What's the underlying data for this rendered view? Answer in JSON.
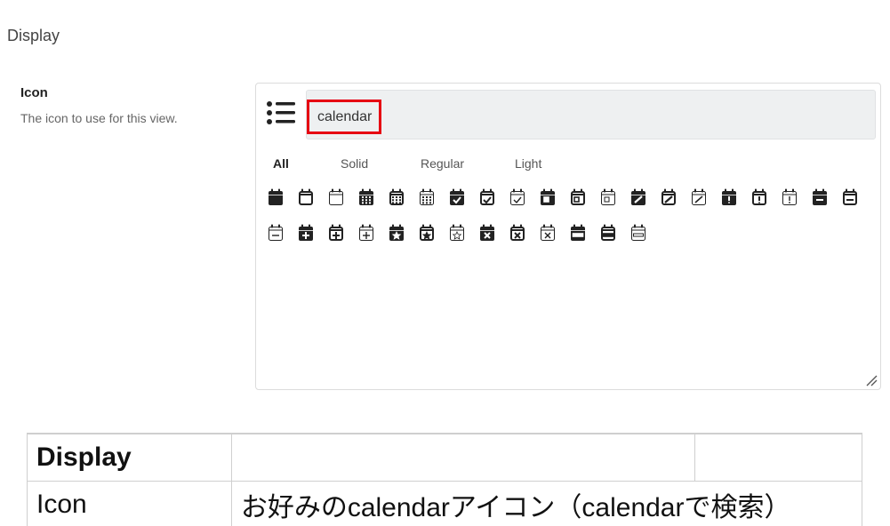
{
  "section": {
    "title": "Display"
  },
  "field": {
    "label": "Icon",
    "description": "The icon to use for this view."
  },
  "picker": {
    "list_icon": "list-icon",
    "search_value": "calendar",
    "tabs": [
      {
        "label": "All",
        "active": true
      },
      {
        "label": "Solid",
        "active": false
      },
      {
        "label": "Regular",
        "active": false
      },
      {
        "label": "Light",
        "active": false
      }
    ],
    "row1": [
      "calendar-solid-icon",
      "calendar-regular-icon",
      "calendar-light-icon",
      "calendar-alt-solid-icon",
      "calendar-alt-regular-icon",
      "calendar-alt-light-icon",
      "calendar-check-solid-icon",
      "calendar-check-regular-icon",
      "calendar-check-light-icon",
      "calendar-day-solid-icon",
      "calendar-day-regular-icon",
      "calendar-day-light-icon",
      "calendar-edit-solid-icon",
      "calendar-edit-regular-icon",
      "calendar-edit-light-icon",
      "calendar-exclamation-solid-icon",
      "calendar-exclamation-regular-icon",
      "calendar-exclamation-light-icon",
      "calendar-minus-solid-icon",
      "calendar-minus-regular-icon"
    ],
    "row2": [
      "calendar-minus-light-icon",
      "calendar-plus-solid-icon",
      "calendar-plus-regular-icon",
      "calendar-plus-light-icon",
      "calendar-star-solid-icon",
      "calendar-star-regular-icon",
      "calendar-star-light-icon",
      "calendar-times-solid-icon",
      "calendar-times-regular-icon",
      "calendar-times-light-icon",
      "calendar-week-solid-icon",
      "calendar-week-regular-icon",
      "calendar-week-light-icon"
    ],
    "accent_color": "#e60012"
  },
  "table": {
    "rows": [
      {
        "col1": "Display",
        "col2": "",
        "col3": ""
      },
      {
        "col1": "Icon",
        "col2": "お好みのcalendarアイコン（calendarで検索）"
      }
    ]
  }
}
